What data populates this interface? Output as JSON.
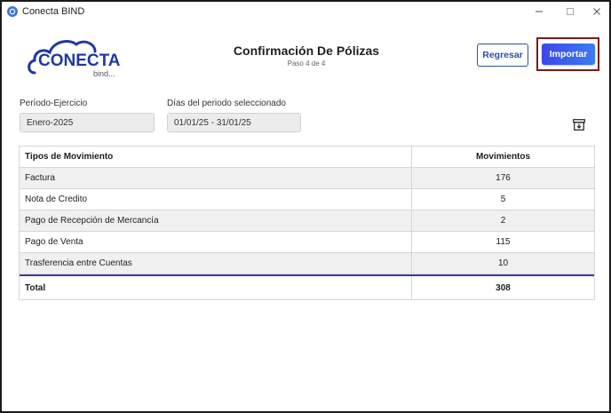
{
  "window": {
    "title": "Conecta BIND"
  },
  "logo": {
    "main_text": "CONECTA",
    "sub_text": "bind..."
  },
  "header": {
    "title": "Confirmación De Pólizas",
    "step": "Paso 4 de 4"
  },
  "buttons": {
    "back_label": "Regresar",
    "import_label": "Importar"
  },
  "fields": {
    "periodo_label": "Período-Ejercicio",
    "periodo_value": "Enero-2025",
    "dias_label": "Días del periodo seleccionado",
    "dias_value": "01/01/25 - 31/01/25"
  },
  "table": {
    "headers": [
      "Tipos de Movimiento",
      "Movimientos"
    ],
    "rows": [
      {
        "type": "Factura",
        "count": "176"
      },
      {
        "type": "Nota de Credito",
        "count": "5"
      },
      {
        "type": "Pago de Recepción de Mercancía",
        "count": "2"
      },
      {
        "type": "Pago de Venta",
        "count": "115"
      },
      {
        "type": "Trasferencia entre Cuentas",
        "count": "10"
      }
    ],
    "total": {
      "label": "Total",
      "count": "308"
    }
  },
  "colors": {
    "accent": "#3d46e8",
    "logo_blue": "#1e3aa0",
    "total_border": "#3e3aa6"
  },
  "icons": {
    "app": "app-logo-icon",
    "archive": "archive-download-icon"
  }
}
